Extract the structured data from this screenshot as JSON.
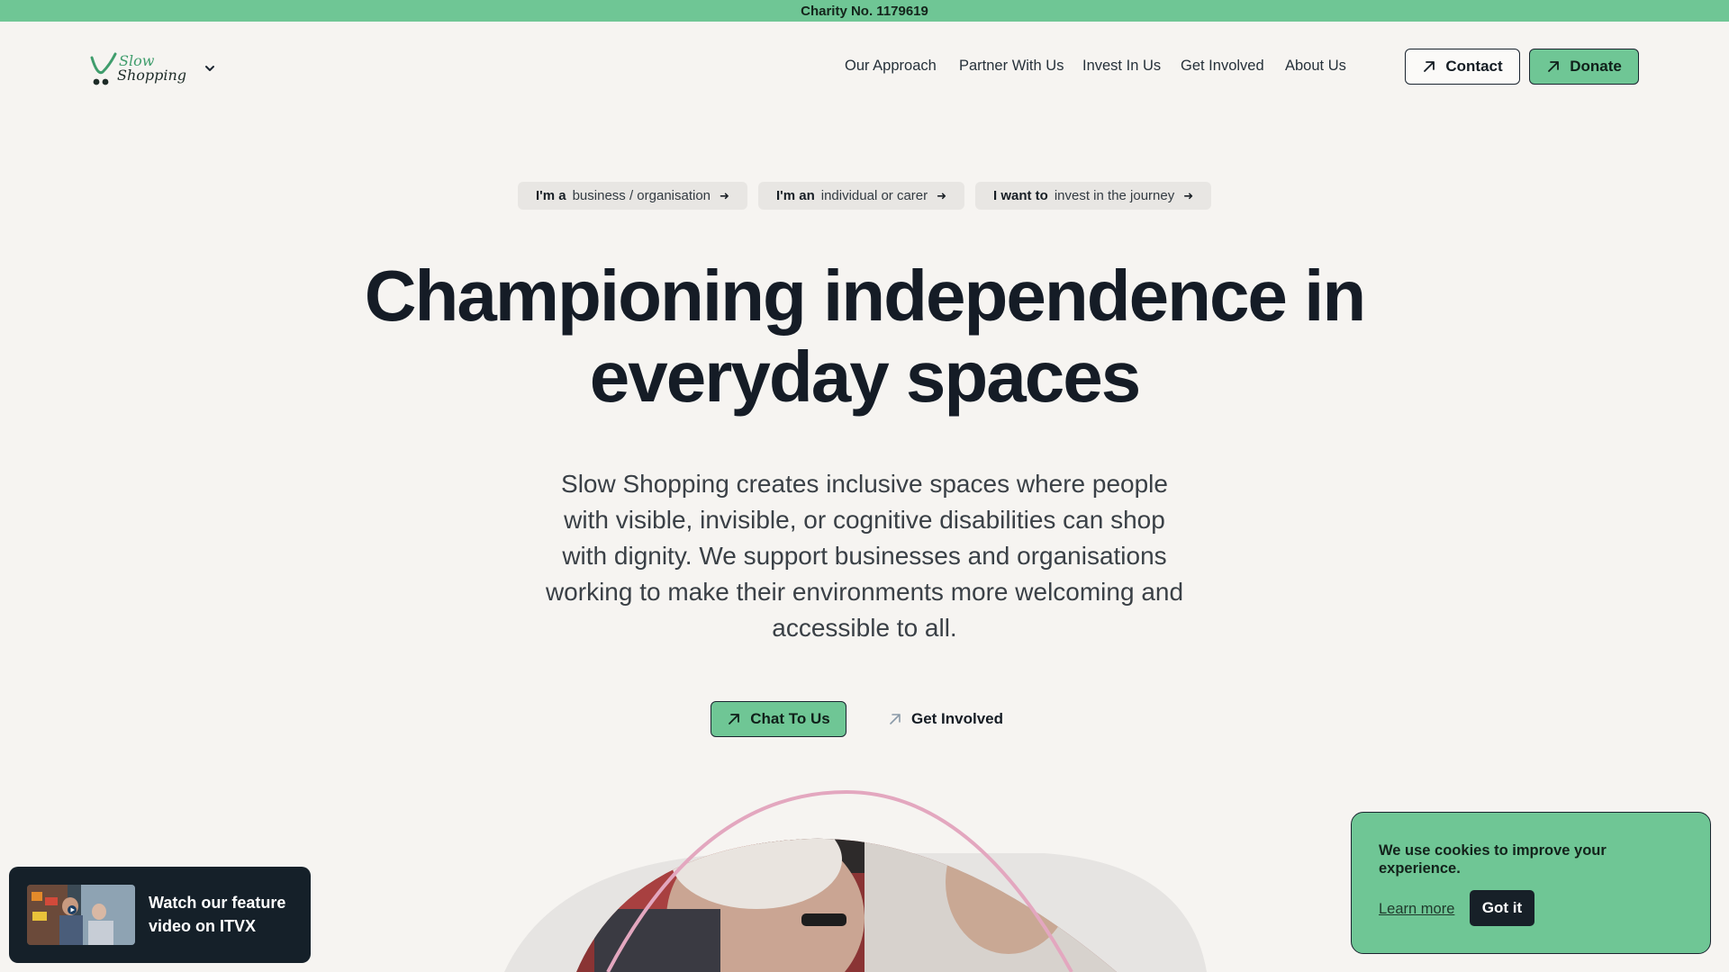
{
  "topbar": {
    "charity": "Charity No. 1179619"
  },
  "logo": {
    "line1": "Slow",
    "line2": "Shopping"
  },
  "nav": {
    "items": [
      "Our Approach",
      "Partner With Us",
      "Invest In Us",
      "Get Involved",
      "About Us"
    ],
    "contact": "Contact",
    "donate": "Donate"
  },
  "pills": [
    {
      "bold": "I'm a",
      "text": "business / organisation"
    },
    {
      "bold": "I'm an",
      "text": "individual or carer"
    },
    {
      "bold": "I want to",
      "text": "invest in the journey"
    }
  ],
  "hero": {
    "title_line1": "Championing independence in",
    "title_line2": "everyday spaces",
    "text": "Slow Shopping creates inclusive spaces where people with visible, invisible, or cognitive disabilities can shop with dignity. We support businesses and organisations working to make their environments more welcoming and accessible to all.",
    "cta_primary": "Chat To Us",
    "cta_secondary": "Get Involved"
  },
  "video": {
    "text": "Watch our feature video on ITVX"
  },
  "cookie": {
    "message": "We use cookies to improve your experience.",
    "learn_more": "Learn more",
    "accept": "Got it"
  },
  "colors": {
    "brand_green": "#6fc695",
    "dark": "#172028",
    "background": "#f6f4f1"
  }
}
